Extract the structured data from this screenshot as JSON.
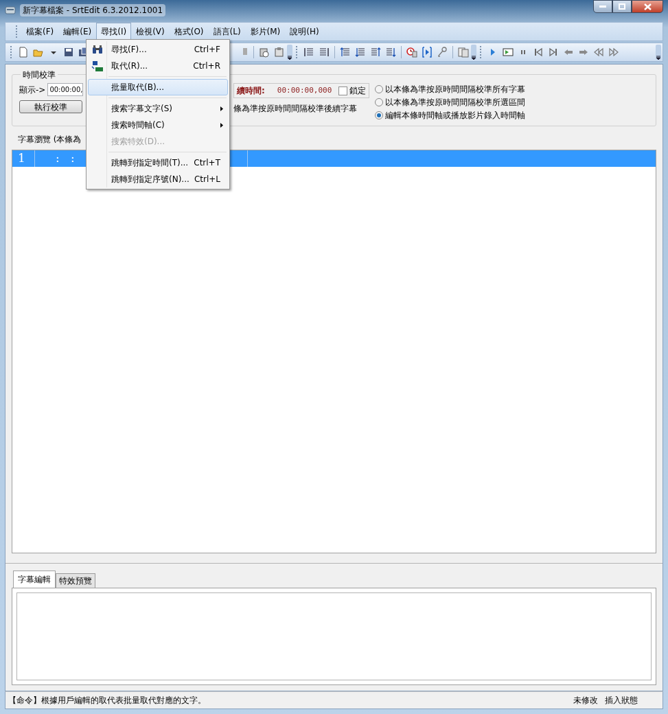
{
  "window": {
    "title": "新字幕檔案 - SrtEdit 6.3.2012.1001"
  },
  "menubar": [
    {
      "label": "檔案(F)",
      "selected": false
    },
    {
      "label": "編輯(E)",
      "selected": false
    },
    {
      "label": "尋找(I)",
      "selected": true
    },
    {
      "label": "檢視(V)",
      "selected": false
    },
    {
      "label": "格式(O)",
      "selected": false
    },
    {
      "label": "語言(L)",
      "selected": false
    },
    {
      "label": "影片(M)",
      "selected": false
    },
    {
      "label": "說明(H)",
      "selected": false
    }
  ],
  "open_menu": {
    "items": [
      {
        "kind": "item",
        "label": "尋找(F)...",
        "shortcut": "Ctrl+F",
        "selected": false,
        "disabled": false,
        "submenu": false
      },
      {
        "kind": "item",
        "label": "取代(R)...",
        "shortcut": "Ctrl+R",
        "selected": false,
        "disabled": false,
        "submenu": false
      },
      {
        "kind": "separator"
      },
      {
        "kind": "item",
        "label": "批量取代(B)...",
        "selected": true,
        "disabled": false,
        "submenu": false
      },
      {
        "kind": "separator"
      },
      {
        "kind": "item",
        "label": "搜索字幕文字(S)",
        "selected": false,
        "disabled": false,
        "submenu": true
      },
      {
        "kind": "item",
        "label": "搜索時間軸(C)",
        "selected": false,
        "disabled": false,
        "submenu": true
      },
      {
        "kind": "item",
        "label": "搜索特效(D)...",
        "selected": false,
        "disabled": true,
        "submenu": false
      },
      {
        "kind": "separator"
      },
      {
        "kind": "item",
        "label": "跳轉到指定時間(T)...",
        "shortcut": "Ctrl+T",
        "selected": false,
        "disabled": false,
        "submenu": false
      },
      {
        "kind": "item",
        "label": "跳轉到指定序號(N)...",
        "shortcut": "Ctrl+L",
        "selected": false,
        "disabled": false,
        "submenu": false
      }
    ]
  },
  "calibration": {
    "title": "時間校準",
    "display_label": "顯示->",
    "display_value": "00:00:00,",
    "duration_label": "續時間:",
    "duration_value": "00:00:00,000",
    "lock": {
      "label": "鎖定",
      "checked": false
    },
    "run_button": "執行校準",
    "hint": "條為準按原時間間隔校準後續字幕",
    "options": [
      {
        "label": "以本條為準按原時間間隔校準所有字幕",
        "selected": false
      },
      {
        "label": "以本條為準按原時間間隔校準所選區間",
        "selected": false
      },
      {
        "label": "編輯本條時間軸或播放影片錄入時間軸",
        "selected": true
      }
    ]
  },
  "browser": {
    "title": "字幕瀏覽 (本條為",
    "rows": [
      {
        "index": "1",
        "time": ":   :",
        "selected": true
      }
    ]
  },
  "editor": {
    "tabs": [
      {
        "label": "字幕編輯",
        "selected": true
      },
      {
        "label": "特效預覽",
        "selected": false
      }
    ]
  },
  "status_bar": {
    "message": "【命令】根據用戶編輯的取代表批量取代對應的文字。",
    "modified": "未修改",
    "mode": "插入狀態"
  }
}
